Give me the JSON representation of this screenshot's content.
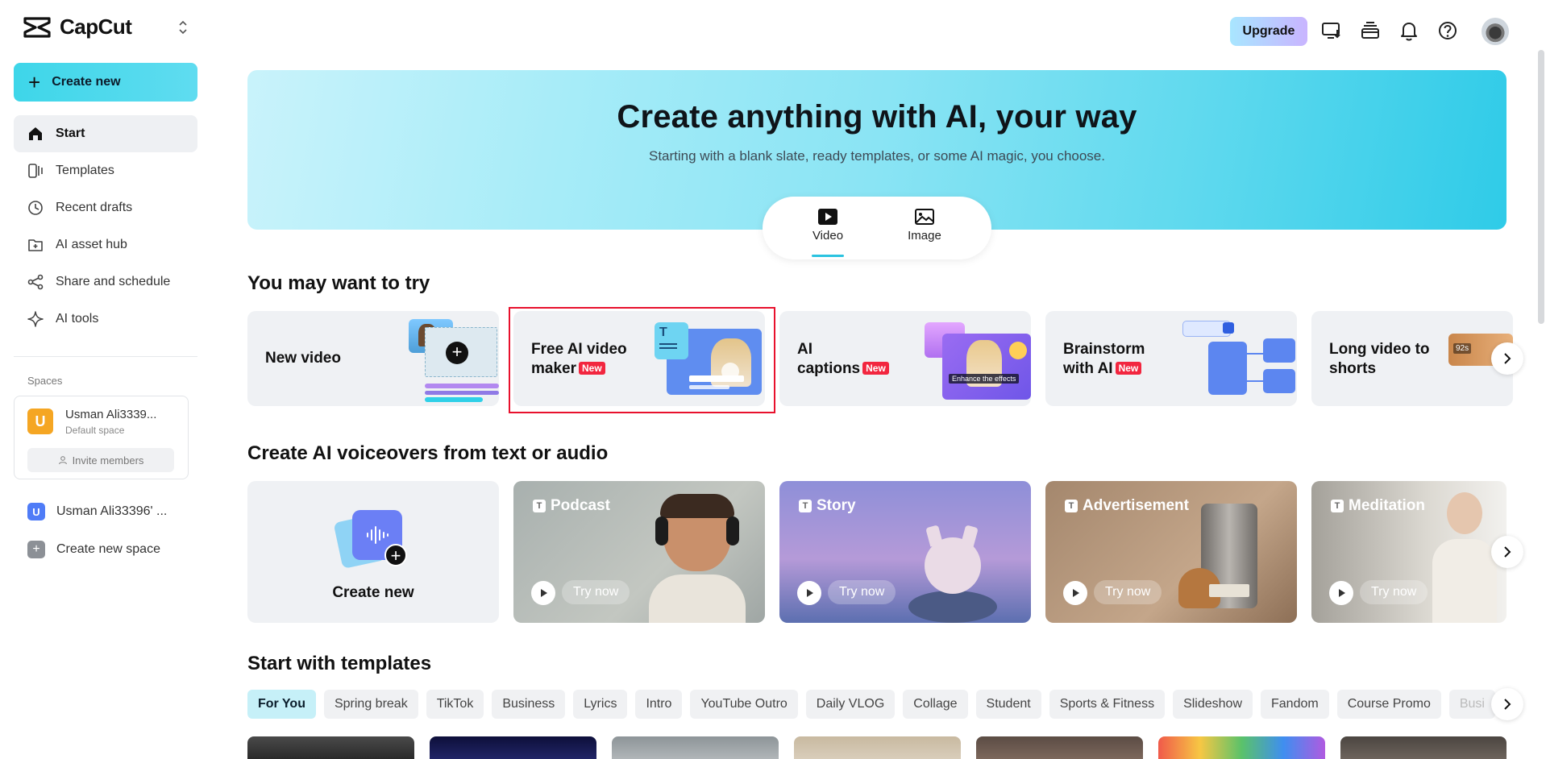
{
  "app": {
    "name": "CapCut"
  },
  "sidebar": {
    "create_new": "Create new",
    "items": [
      {
        "label": "Start",
        "icon": "home-icon",
        "active": true
      },
      {
        "label": "Templates",
        "icon": "templates-icon"
      },
      {
        "label": "Recent drafts",
        "icon": "clock-icon"
      },
      {
        "label": "AI asset hub",
        "icon": "asset-hub-icon"
      },
      {
        "label": "Share and schedule",
        "icon": "share-icon"
      },
      {
        "label": "AI tools",
        "icon": "sparkle-icon"
      }
    ],
    "spaces_label": "Spaces",
    "space": {
      "initial": "U",
      "name": "Usman Ali3339...",
      "sub": "Default space",
      "invite": "Invite members"
    },
    "other_space": {
      "initial": "U",
      "name": "Usman Ali33396' ..."
    },
    "create_space": "Create new space"
  },
  "header": {
    "upgrade": "Upgrade"
  },
  "hero": {
    "title": "Create anything with AI, your way",
    "subtitle": "Starting with a blank slate, ready templates, or some AI magic, you choose.",
    "modes": [
      "Video",
      "Image"
    ],
    "active_mode": "Video"
  },
  "try_section": {
    "title": "You may want to try",
    "cards": [
      {
        "line1": "New video",
        "line2": "",
        "new_badge": ""
      },
      {
        "line1": "Free AI video",
        "line2": "maker",
        "new_badge": "New"
      },
      {
        "line1": "AI",
        "line2": "captions",
        "new_badge": "New"
      },
      {
        "line1": "Brainstorm",
        "line2": "with AI",
        "new_badge": "New"
      },
      {
        "line1": "Long video to",
        "line2": "shorts",
        "new_badge": ""
      }
    ],
    "caption_overlay": "Enhance the effects",
    "duration_badge": "92s"
  },
  "voiceover_section": {
    "title": "Create AI voiceovers from text or audio",
    "create_new": "Create new",
    "cards": [
      {
        "label": "Podcast",
        "try": "Try now"
      },
      {
        "label": "Story",
        "try": "Try now"
      },
      {
        "label": "Advertisement",
        "try": "Try now"
      },
      {
        "label": "Meditation",
        "try": "Try now"
      }
    ],
    "tbox": "T"
  },
  "templates_section": {
    "title": "Start with templates",
    "chips": [
      "For You",
      "Spring break",
      "TikTok",
      "Business",
      "Lyrics",
      "Intro",
      "YouTube Outro",
      "Daily VLOG",
      "Collage",
      "Student",
      "Sports & Fitness",
      "Slideshow",
      "Fandom",
      "Course Promo",
      "Busi"
    ],
    "active_chip": "For You"
  },
  "colors": {
    "accent": "#2bc3e0",
    "new_badge": "#f2263f",
    "highlight": "#e8112d"
  }
}
